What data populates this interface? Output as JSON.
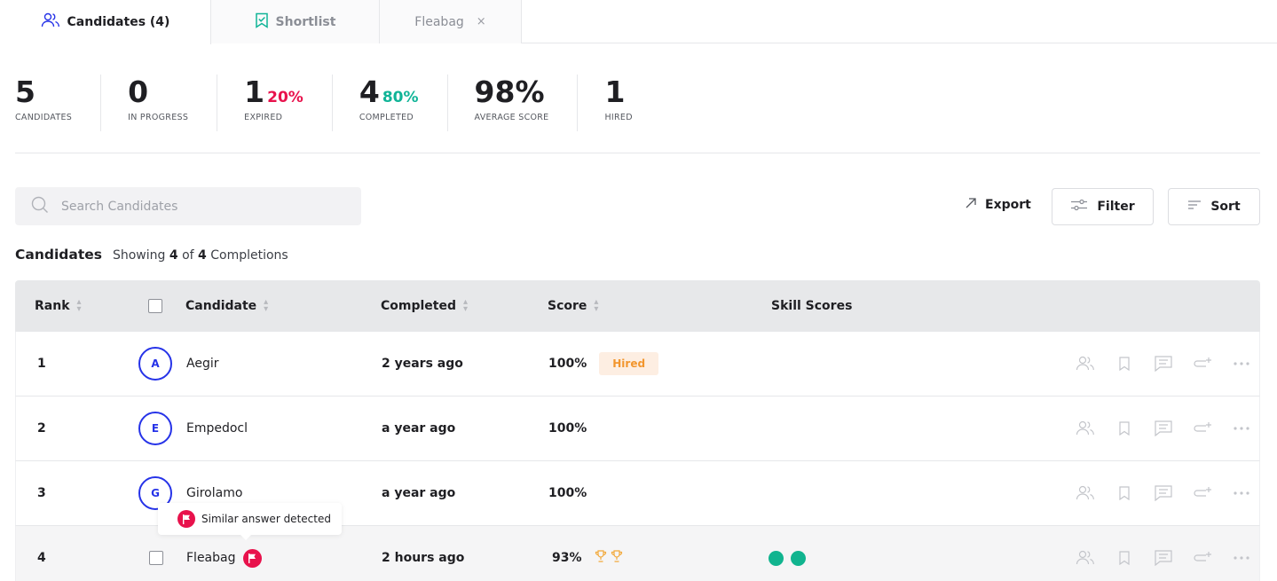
{
  "tabs": [
    {
      "label": "Candidates (4)",
      "icon": "users-icon"
    },
    {
      "label": "Shortlist",
      "icon": "shortlist-icon"
    },
    {
      "label": "Fleabag",
      "close": "×"
    }
  ],
  "stats": [
    {
      "value": "5",
      "label": "CANDIDATES"
    },
    {
      "value": "0",
      "label": "IN PROGRESS"
    },
    {
      "value": "1",
      "pct": "20%",
      "label": "EXPIRED",
      "pct_color": "#e8124c"
    },
    {
      "value": "4",
      "pct": "80%",
      "label": "COMPLETED",
      "pct_color": "#10b497"
    },
    {
      "value": "98%",
      "label": "AVERAGE SCORE"
    },
    {
      "value": "1",
      "label": "HIRED"
    }
  ],
  "toolbar": {
    "search_placeholder": "Search Candidates",
    "export_label": "Export",
    "filter_label": "Filter",
    "sort_label": "Sort"
  },
  "heading": {
    "title": "Candidates",
    "showing_prefix": "Showing",
    "shown": "4",
    "of": "of",
    "total": "4",
    "suffix": "Completions"
  },
  "table": {
    "columns": [
      "Rank",
      "Candidate",
      "Completed",
      "Score",
      "Skill Scores"
    ],
    "rows": [
      {
        "rank": "1",
        "initial": "A",
        "name": "Aegir",
        "completed": "2 years ago",
        "score": "100%",
        "badge": "Hired"
      },
      {
        "rank": "2",
        "initial": "E",
        "name": "Empedocl",
        "completed": "a year ago",
        "score": "100%"
      },
      {
        "rank": "3",
        "initial": "G",
        "name": "Girolamo",
        "completed": "a year ago",
        "score": "100%"
      },
      {
        "rank": "4",
        "name": "Fleabag",
        "completed": "2 hours ago",
        "score": "93%",
        "flagged": true,
        "trophies": 2,
        "skill_dots": 2
      }
    ]
  },
  "tooltip": {
    "text": "Similar answer detected"
  },
  "colors": {
    "accent": "#2633e8",
    "red": "#e8124c",
    "green": "#10b497",
    "hired_bg": "#fdeee2",
    "hired_text": "#f2962e",
    "trophy": "#f2a93b"
  }
}
